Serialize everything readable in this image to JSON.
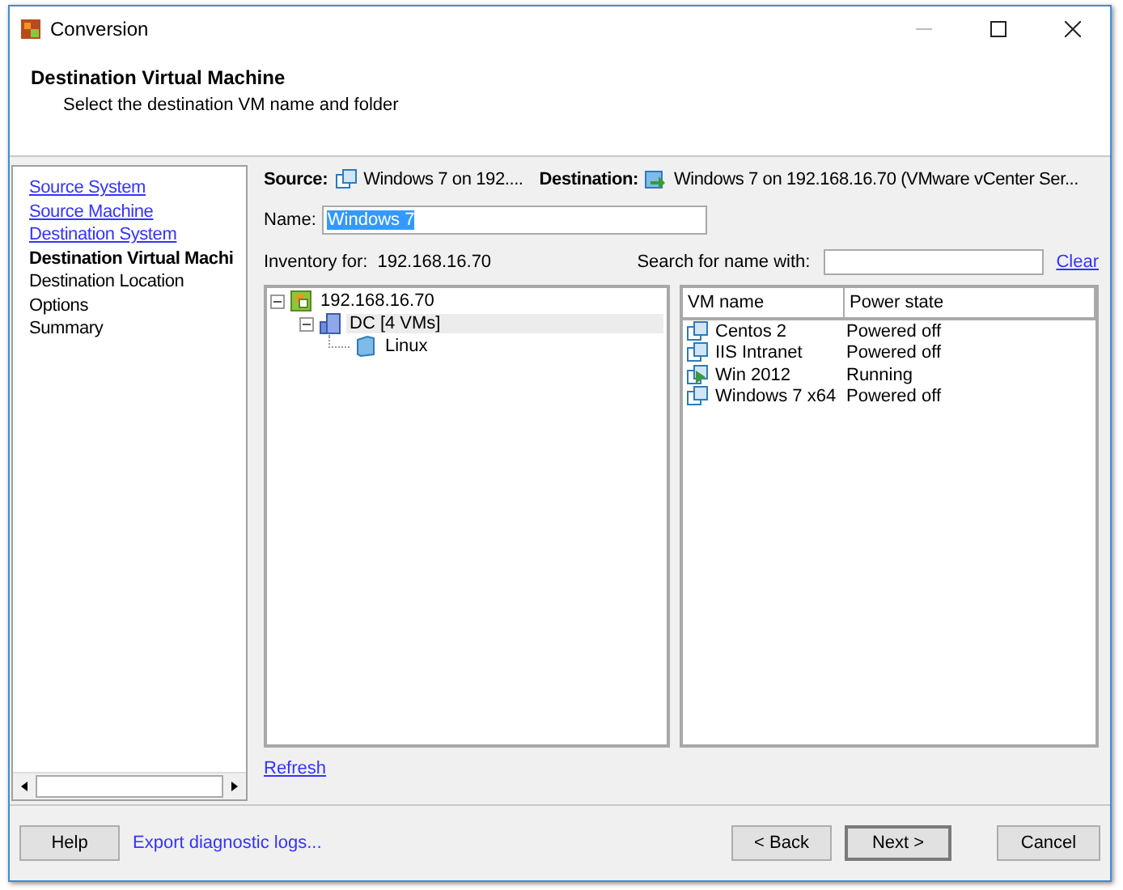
{
  "window": {
    "title": "Conversion"
  },
  "header": {
    "title": "Destination Virtual Machine",
    "subtitle": "Select the destination VM name and folder"
  },
  "steps": [
    {
      "label": "Source System",
      "kind": "done"
    },
    {
      "label": "Source Machine",
      "kind": "done"
    },
    {
      "label": "Destination System",
      "kind": "done"
    },
    {
      "label": "Destination Virtual Machi",
      "kind": "current"
    },
    {
      "label": "Destination Location",
      "kind": "pending"
    },
    {
      "label": "Options",
      "kind": "pending"
    },
    {
      "label": "Summary",
      "kind": "pending"
    }
  ],
  "source": {
    "label": "Source:",
    "value": "Windows 7 on 192...."
  },
  "destination": {
    "label": "Destination:",
    "value": "Windows 7 on 192.168.16.70 (VMware vCenter Ser..."
  },
  "name_field": {
    "label": "Name:",
    "value": "Windows 7",
    "text_selected": true
  },
  "inventory": {
    "label": "Inventory for:",
    "value": "192.168.16.70"
  },
  "search": {
    "label": "Search for name with:",
    "clear": "Clear"
  },
  "tree": [
    {
      "label": "192.168.16.70",
      "kind": "host",
      "selected": false,
      "expanded": true,
      "children": [
        {
          "label": "DC [4 VMs]",
          "kind": "datacenter",
          "selected": true,
          "expanded": true,
          "children": [
            {
              "label": "Linux",
              "kind": "folder",
              "selected": false
            }
          ]
        }
      ]
    }
  ],
  "vm_table": {
    "columns": [
      "VM name",
      "Power state"
    ],
    "rows": [
      {
        "name": "Centos 2",
        "state": "Powered off",
        "kind": "off"
      },
      {
        "name": "IIS Intranet",
        "state": "Powered off",
        "kind": "off"
      },
      {
        "name": "Win 2012",
        "state": "Running",
        "kind": "running"
      },
      {
        "name": "Windows 7 x64",
        "state": "Powered off",
        "kind": "off"
      }
    ]
  },
  "refresh": "Refresh",
  "buttons": {
    "help": "Help",
    "export": "Export diagnostic logs...",
    "back": "< Back",
    "next": "Next >",
    "cancel": "Cancel"
  }
}
